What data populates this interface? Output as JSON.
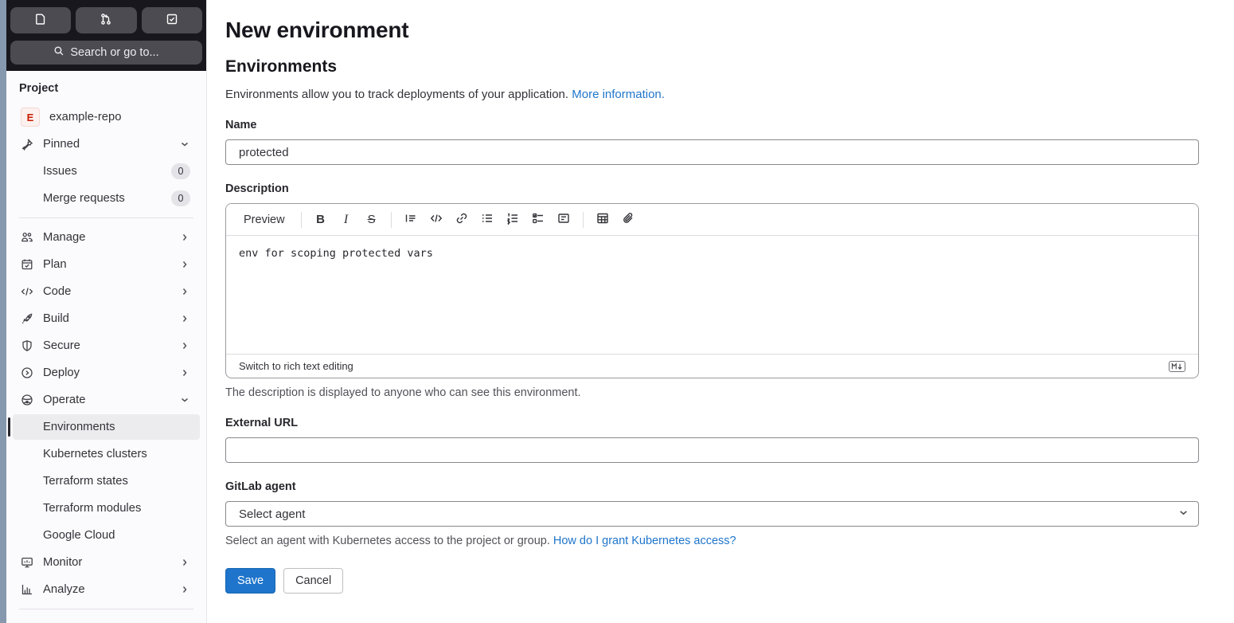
{
  "topbar": {
    "buttons": [
      {
        "icon": "issues-icon"
      },
      {
        "icon": "merge-request-icon"
      },
      {
        "icon": "todo-checklist-icon"
      }
    ],
    "search_label": "Search or go to..."
  },
  "sidebar": {
    "section_label": "Project",
    "project": {
      "avatar_letter": "E",
      "name": "example-repo"
    },
    "pinned": {
      "label": "Pinned",
      "icon": "pin-icon"
    },
    "pinned_items": [
      {
        "label": "Issues",
        "badge": "0"
      },
      {
        "label": "Merge requests",
        "badge": "0"
      }
    ],
    "nav": [
      {
        "label": "Manage",
        "icon": "users-icon"
      },
      {
        "label": "Plan",
        "icon": "calendar-icon"
      },
      {
        "label": "Code",
        "icon": "code-icon"
      },
      {
        "label": "Build",
        "icon": "rocket-icon"
      },
      {
        "label": "Secure",
        "icon": "shield-icon"
      },
      {
        "label": "Deploy",
        "icon": "deploy-icon"
      },
      {
        "label": "Operate",
        "icon": "operate-icon"
      }
    ],
    "operate_items": [
      {
        "label": "Environments"
      },
      {
        "label": "Kubernetes clusters"
      },
      {
        "label": "Terraform states"
      },
      {
        "label": "Terraform modules"
      },
      {
        "label": "Google Cloud"
      }
    ],
    "nav_bottom": [
      {
        "label": "Monitor",
        "icon": "monitor-icon"
      },
      {
        "label": "Analyze",
        "icon": "chart-icon"
      }
    ]
  },
  "main": {
    "title": "New environment",
    "heading": "Environments",
    "intro": {
      "text": "Environments allow you to track deployments of your application.",
      "link": "More information."
    },
    "name": {
      "label": "Name",
      "value": "protected"
    },
    "description": {
      "label": "Description",
      "preview_label": "Preview",
      "value": "env for scoping protected vars",
      "switch_link": "Switch to rich text editing",
      "helper": "The description is displayed to anyone who can see this environment."
    },
    "external_url": {
      "label": "External URL",
      "value": ""
    },
    "agent": {
      "label": "GitLab agent",
      "selected": "Select agent",
      "helper": "Select an agent with Kubernetes access to the project or group.",
      "helper_link": "How do I grant Kubernetes access?"
    },
    "actions": {
      "save": "Save",
      "cancel": "Cancel"
    }
  },
  "colors": {
    "accent_blue": "#1f75cb",
    "topbar_bg": "#18171d",
    "topbar_button_bg": "#4c4b51",
    "sidebar_bg": "#fbfafd",
    "active_item_bg": "#ececef",
    "link_blue": "#1f75cb",
    "avatar_bg": "#fdf1ef",
    "avatar_text": "#c91c00"
  }
}
